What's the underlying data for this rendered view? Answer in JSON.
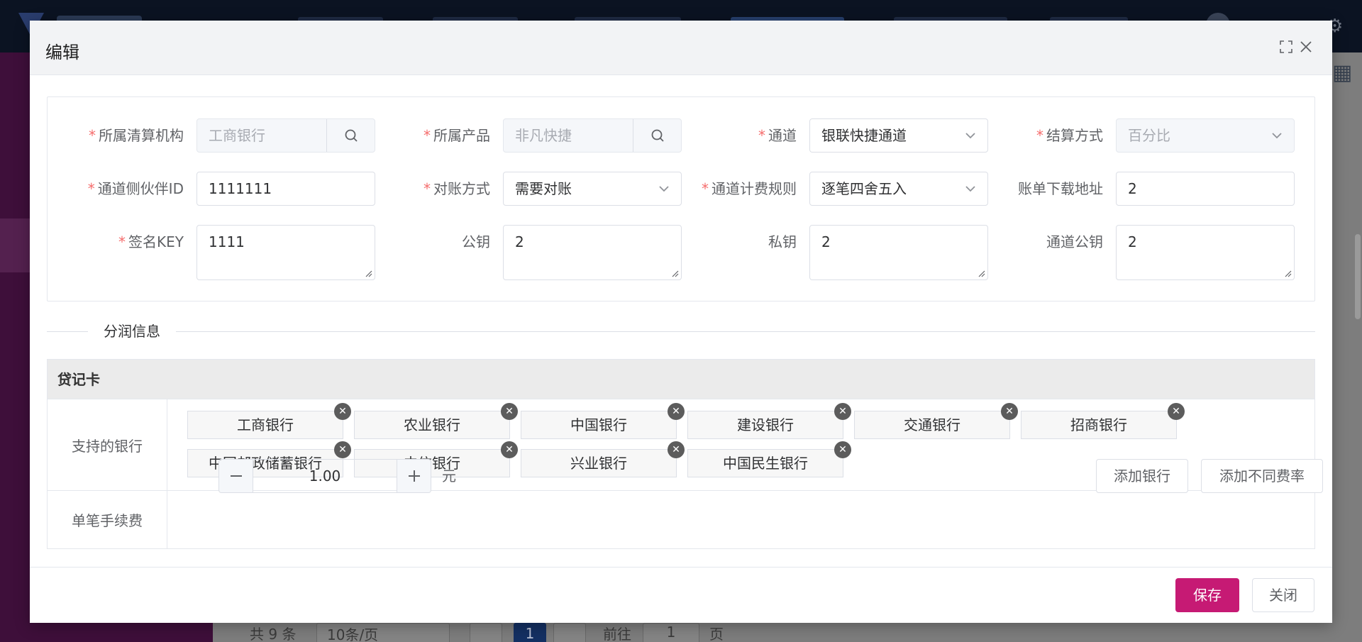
{
  "dialog": {
    "title": "编辑",
    "fields": {
      "org": {
        "label": "所属清算机构",
        "value": "工商银行"
      },
      "product": {
        "label": "所属产品",
        "value": "非凡快捷"
      },
      "channel": {
        "label": "通道",
        "value": "银联快捷通道"
      },
      "settle": {
        "label": "结算方式",
        "value": "百分比"
      },
      "partner_id": {
        "label": "通道侧伙伴ID",
        "value": "1111111"
      },
      "reconcile": {
        "label": "对账方式",
        "value": "需要对账"
      },
      "fee_rule": {
        "label": "通道计费规则",
        "value": "逐笔四舍五入"
      },
      "bill_url": {
        "label": "账单下载地址",
        "value": "2"
      },
      "sign_key": {
        "label": "签名KEY",
        "value": "1111"
      },
      "public_key": {
        "label": "公钥",
        "value": "2"
      },
      "private_key": {
        "label": "私钥",
        "value": "2"
      },
      "channel_public_key": {
        "label": "通道公钥",
        "value": "2"
      }
    },
    "section_title": "分润信息",
    "card_type": "贷记卡",
    "banks_label": "支持的银行",
    "banks": [
      "工商银行",
      "农业银行",
      "中国银行",
      "建设银行",
      "交通银行",
      "招商银行",
      "中国邮政储蓄银行",
      "中信银行",
      "兴业银行",
      "中国民生银行"
    ],
    "fee_label": "单笔手续费",
    "fee_value": "1.00",
    "fee_unit": "元",
    "add_bank_label": "添加银行",
    "add_rate_label": "添加不同费率",
    "save_label": "保存",
    "close_label": "关闭"
  },
  "background": {
    "pager": {
      "total": "共 9 条",
      "page_size": "10条/页",
      "current_page": "1",
      "goto": "前往",
      "goto_value": "1",
      "page_unit": "页"
    }
  },
  "colors": {
    "primary": "#c61a74",
    "required": "#f56c6c",
    "sidebar": "#3e0f3a"
  },
  "icons": {
    "search": "search-icon",
    "caret": "chevron-down-icon",
    "close": "close-icon",
    "fullscreen": "fullscreen-icon",
    "tag_remove": "remove-icon"
  }
}
